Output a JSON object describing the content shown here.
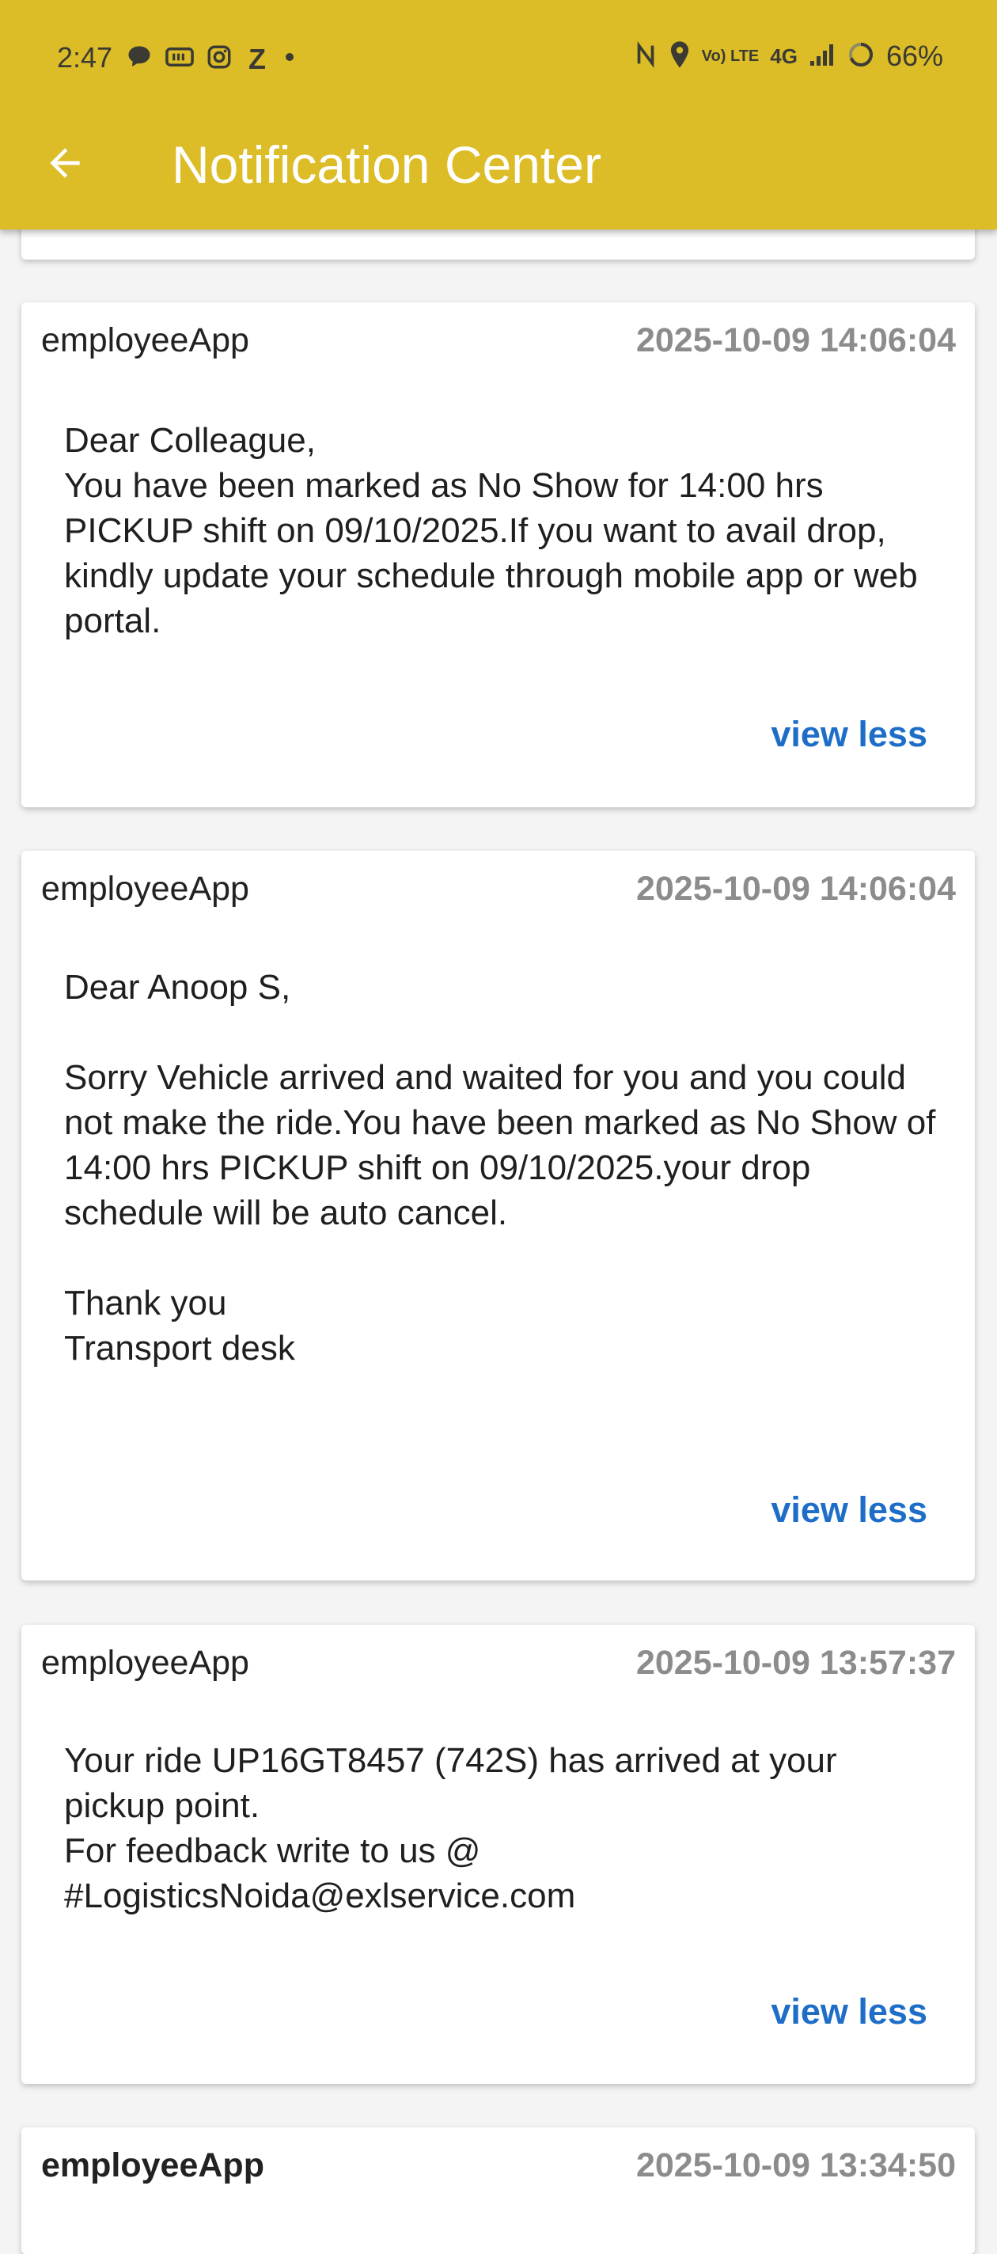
{
  "status_bar": {
    "time": "2:47",
    "left_icons": [
      "message-bubble-icon",
      "paytm-icon",
      "instagram-icon",
      "z-app-icon",
      "dot-icon"
    ],
    "z_glyph": "Z",
    "volte_label": "Vo) LTE",
    "network_label": "4G",
    "battery": "66%"
  },
  "header": {
    "title": "Notification Center",
    "background_color": "#dcbd28"
  },
  "notifications": [
    {
      "source": "employeeApp",
      "time": "2025-10-09 14:06:04",
      "message": "Dear Colleague,\n You have been marked as No Show for 14:00 hrs PICKUP shift on 09/10/2025.If you want to avail drop, kindly update your schedule through mobile app or web portal.",
      "toggle_label": "view less"
    },
    {
      "source": "employeeApp",
      "time": "2025-10-09 14:06:04",
      "message": "Dear Anoop S,\n\nSorry Vehicle arrived and waited for you and you could not make the ride.You have been marked as No Show of 14:00 hrs PICKUP shift on 09/10/2025.your drop schedule will be auto cancel.\n\nThank you\nTransport desk",
      "toggle_label": "view less"
    },
    {
      "source": "employeeApp",
      "time": "2025-10-09 13:57:37",
      "message": "Your ride UP16GT8457 (742S) has arrived at your pickup point.\nFor feedback write to us @\n#LogisticsNoida@exlservice.com",
      "toggle_label": "view less"
    },
    {
      "source": "employeeApp",
      "time": "2025-10-09 13:34:50"
    }
  ],
  "colors": {
    "link": "#1e6ec8",
    "timestamp": "#8c8c8c",
    "page_background": "#f4f4f4"
  }
}
